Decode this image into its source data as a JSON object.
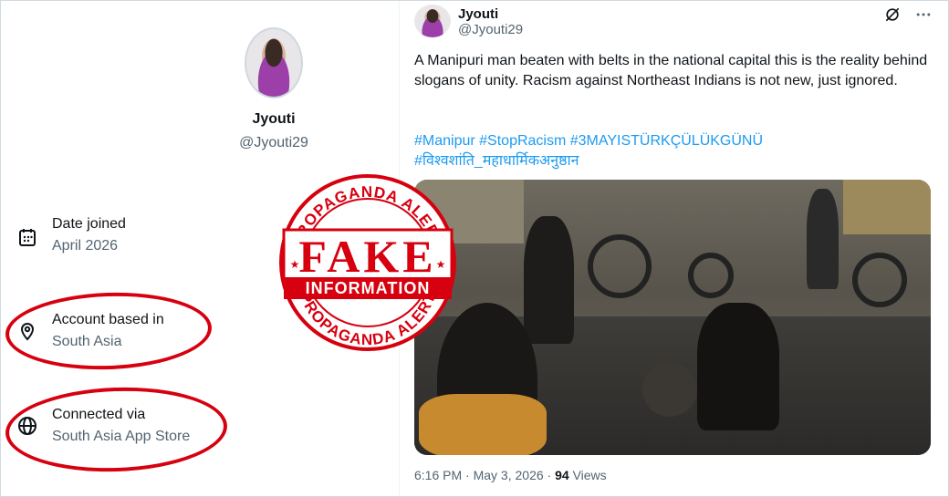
{
  "profile": {
    "name": "Jyouti",
    "handle": "@Jyouti29",
    "avatar": "avatar-photo",
    "info": {
      "date_joined_label": "Date joined",
      "date_joined_value": "April 2026",
      "account_based_label": "Account based in",
      "account_based_value": "South Asia",
      "connected_label": "Connected via",
      "connected_value": "South Asia App Store"
    }
  },
  "tweet": {
    "name": "Jyouti",
    "handle": "@Jyouti29",
    "body": "A Manipuri man beaten with belts in the national capital this is the reality behind slogans of unity. Racism against Northeast Indians is not new, just ignored.",
    "hashtags_line1": "#Manipur #StopRacism #3MAYISTÜRKÇÜLÜKGÜNÜ",
    "hashtags_line2": "#विश्वशांति_महाधार्मिकअनुष्ठान",
    "time": "6:16 PM",
    "date": "May 3, 2026",
    "views_count": "94",
    "views_label": "Views",
    "sep": "·"
  },
  "stamp": {
    "top_text": "PROPAGANDA ALERT",
    "bottom_text": "PROPAGANDA ALERT",
    "line1": "FAKE",
    "line2": "INFORMATION",
    "color": "#d7000f"
  },
  "colors": {
    "link": "#1d9bf0",
    "secondary_text": "#536471",
    "highlight_ring": "#d7000f"
  }
}
